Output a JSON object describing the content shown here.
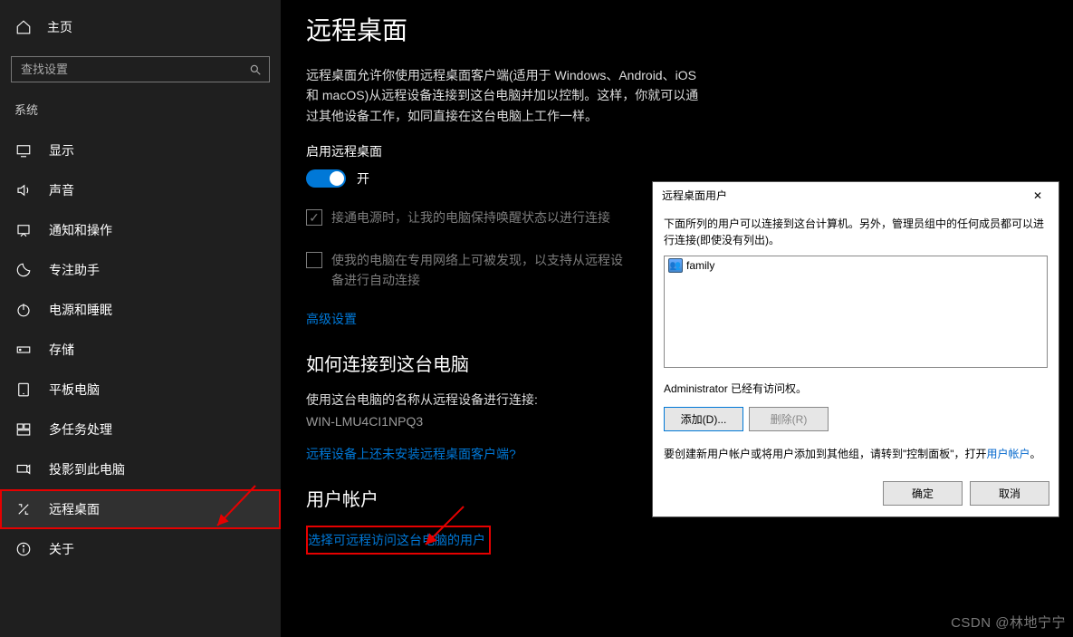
{
  "sidebar": {
    "home": "主页",
    "search_placeholder": "查找设置",
    "category": "系统",
    "items": [
      {
        "label": "显示"
      },
      {
        "label": "声音"
      },
      {
        "label": "通知和操作"
      },
      {
        "label": "专注助手"
      },
      {
        "label": "电源和睡眠"
      },
      {
        "label": "存储"
      },
      {
        "label": "平板电脑"
      },
      {
        "label": "多任务处理"
      },
      {
        "label": "投影到此电脑"
      },
      {
        "label": "远程桌面"
      },
      {
        "label": "关于"
      }
    ]
  },
  "main": {
    "title": "远程桌面",
    "description": "远程桌面允许你使用远程桌面客户端(适用于 Windows、Android、iOS 和 macOS)从远程设备连接到这台电脑并加以控制。这样，你就可以通过其他设备工作，如同直接在这台电脑上工作一样。",
    "enable_label": "启用远程桌面",
    "toggle_state": "开",
    "keep_awake": "接通电源时，让我的电脑保持唤醒状态以进行连接",
    "discoverable": "使我的电脑在专用网络上可被发现，以支持从远程设备进行自动连接",
    "advanced": "高级设置",
    "connect_title": "如何连接到这台电脑",
    "connect_desc": "使用这台电脑的名称从远程设备进行连接:",
    "pc_name": "WIN-LMU4CI1NPQ3",
    "client_link": "远程设备上还未安装远程桌面客户端?",
    "accounts_title": "用户帐户",
    "select_users": "选择可远程访问这台电脑的用户"
  },
  "dialog": {
    "title": "远程桌面用户",
    "close": "✕",
    "desc": "下面所列的用户可以连接到这台计算机。另外，管理员组中的任何成员都可以进行连接(即使没有列出)。",
    "user": "family",
    "admin_note": "Administrator 已经有访问权。",
    "add": "添加(D)...",
    "remove": "删除(R)",
    "create_note_pre": "要创建新用户帐户或将用户添加到其他组，请转到\"控制面板\"，打开",
    "create_note_link": "用户帐户",
    "create_note_post": "。",
    "ok": "确定",
    "cancel": "取消"
  },
  "watermark": "CSDN @林地宁宁"
}
